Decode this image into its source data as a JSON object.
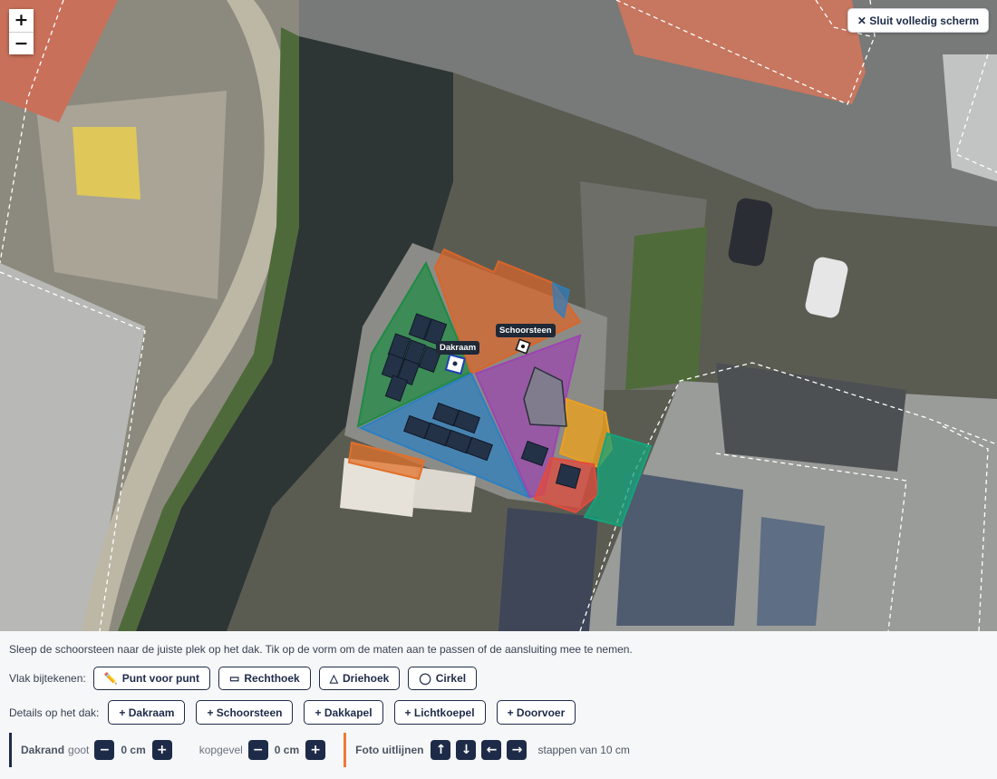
{
  "map": {
    "zoom_in_label": "+",
    "zoom_out_label": "−",
    "fullscreen_label": "✕ Sluit volledig scherm",
    "markers": {
      "dakraam_label": "Dakraam",
      "schoorsteen_label": "Schoorsteen"
    }
  },
  "panel": {
    "instruction": "Sleep de schoorsteen naar de juiste plek op het dak. Tik op de vorm om de maten aan te passen of de aansluiting mee te nemen.",
    "draw_label": "Vlak bijtekenen:",
    "draw_tools": [
      {
        "icon": "✏️",
        "label": "Punt voor punt"
      },
      {
        "icon": "▭",
        "label": "Rechthoek"
      },
      {
        "icon": "△",
        "label": "Driehoek"
      },
      {
        "icon": "◯",
        "label": "Cirkel"
      }
    ],
    "details_label": "Details op het dak:",
    "details": [
      "+ Dakraam",
      "+ Schoorsteen",
      "+ Dakkapel",
      "+ Lichtkoepel",
      "+ Doorvoer"
    ],
    "dakrand": {
      "title": "Dakrand",
      "goot_label": "goot",
      "goot_value": "0 cm",
      "kopgevel_label": "kopgevel",
      "kopgevel_value": "0 cm",
      "minus": "−",
      "plus": "+"
    },
    "foto": {
      "title": "Foto uitlijnen",
      "up": "↑",
      "down": "↓",
      "left": "←",
      "right": "→",
      "steps": "stappen van 10 cm"
    }
  }
}
